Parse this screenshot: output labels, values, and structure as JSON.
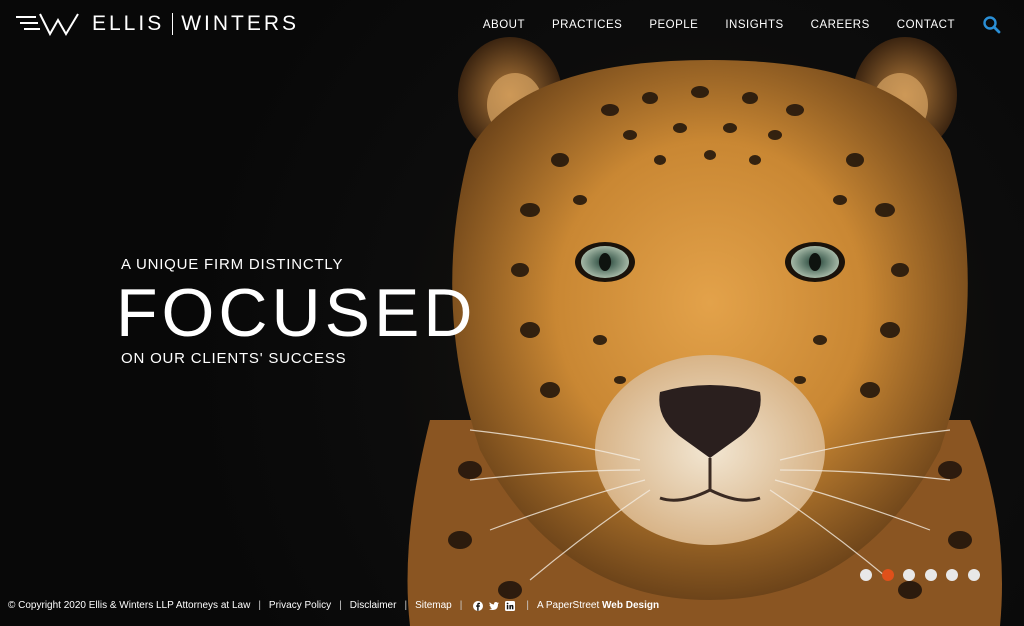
{
  "brand": {
    "name_left": "ELLIS",
    "name_right": "WINTERS",
    "logo_icon": "ellis-winters-w-mark"
  },
  "nav": {
    "items": [
      "ABOUT",
      "PRACTICES",
      "PEOPLE",
      "INSIGHTS",
      "CAREERS",
      "CONTACT"
    ],
    "search_icon": "search-icon"
  },
  "hero": {
    "tagline_top": "A UNIQUE FIRM DISTINCTLY",
    "headline": "FOCUSED",
    "tagline_bottom": "ON OUR CLIENTS' SUCCESS",
    "image": "leopard-face"
  },
  "slider": {
    "count": 6,
    "active_index": 1,
    "active_color": "#e0501a",
    "inactive_color": "#e8e8e8"
  },
  "footer": {
    "copyright": "© Copyright 2020 Ellis & Winters LLP Attorneys at Law",
    "links": [
      "Privacy Policy",
      "Disclaimer",
      "Sitemap"
    ],
    "social_icons": [
      "facebook-icon",
      "twitter-icon",
      "linkedin-icon"
    ],
    "credit_prefix": "A PaperStreet",
    "credit_bold": "Web Design"
  },
  "colors": {
    "background": "#0b0b0b",
    "text": "#ffffff",
    "search_accent": "#2a8fd6"
  }
}
